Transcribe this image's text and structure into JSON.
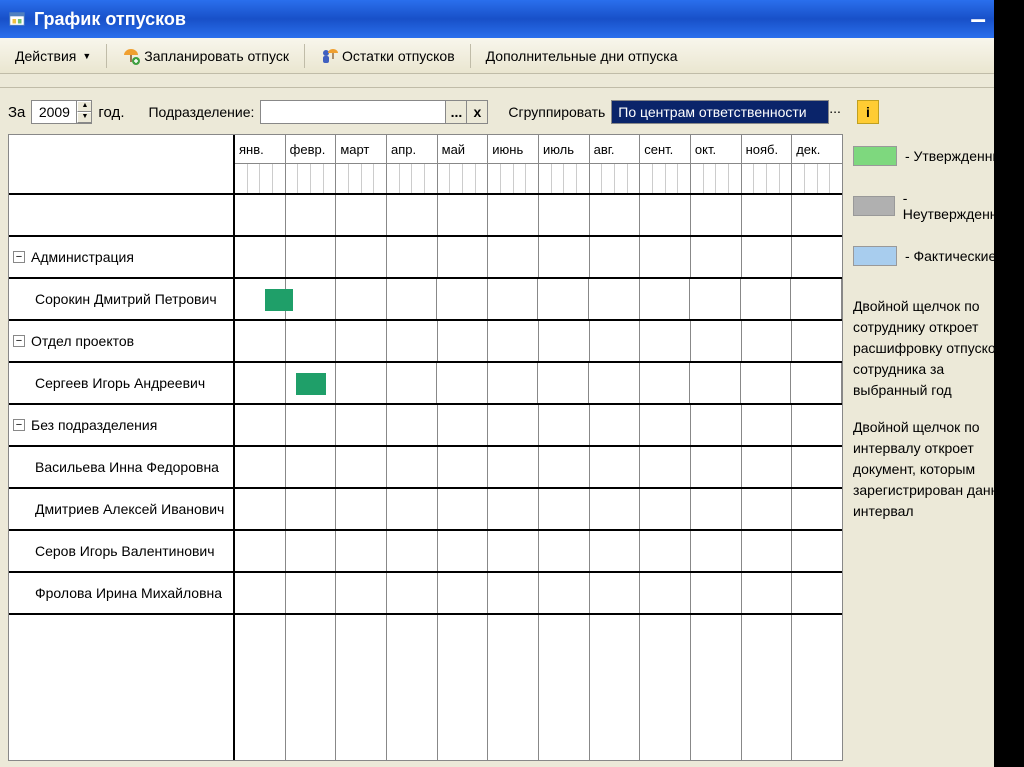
{
  "window": {
    "title": "График отпусков"
  },
  "toolbar": {
    "actions": "Действия",
    "plan": "Запланировать отпуск",
    "remainders": "Остатки отпусков",
    "extra_days": "Дополнительные дни отпуска"
  },
  "filters": {
    "za_label": "За",
    "year": "2009",
    "god_label": "год.",
    "division_label": "Подразделение:",
    "division_value": "",
    "group_label": "Сгруппировать",
    "group_value": "По центрам ответственности",
    "ellipsis": "...",
    "clear": "x",
    "info": "i"
  },
  "months": [
    "янв.",
    "февр.",
    "март",
    "апр.",
    "май",
    "июнь",
    "июль",
    "авг.",
    "сент.",
    "окт.",
    "нояб.",
    "дек."
  ],
  "rows": [
    {
      "type": "group",
      "label": "Администрация"
    },
    {
      "type": "employee",
      "label": "Сорокин Дмитрий Петрович",
      "bar": {
        "left_pct": 5.0,
        "width_pct": 4.5
      }
    },
    {
      "type": "group",
      "label": "Отдел проектов"
    },
    {
      "type": "employee",
      "label": "Сергеев Игорь Андреевич",
      "bar": {
        "left_pct": 10.0,
        "width_pct": 5.0
      }
    },
    {
      "type": "group",
      "label": "Без подразделения"
    },
    {
      "type": "employee",
      "label": "Васильева Инна Федоровна"
    },
    {
      "type": "employee",
      "label": "Дмитриев Алексей Иванович"
    },
    {
      "type": "employee",
      "label": "Серов Игорь Валентинович"
    },
    {
      "type": "employee",
      "label": "Фролова Ирина Михайловна"
    }
  ],
  "legend": {
    "approved": {
      "label": "- Утвержденные",
      "color": "#7ed87e"
    },
    "unapproved": {
      "label": "- Неутвержденные",
      "color": "#b0b0b0"
    },
    "actual": {
      "label": "- Фактические",
      "color": "#a8cdee"
    }
  },
  "hints": {
    "hint1": "Двойной щелчок по сотруднику откроет расшифровку отпусков сотрудника за выбранный год",
    "hint2": "Двойной щелчок по интервалу откроет документ, которым зарегистрирован данный интервал"
  },
  "expander_glyph": "−"
}
